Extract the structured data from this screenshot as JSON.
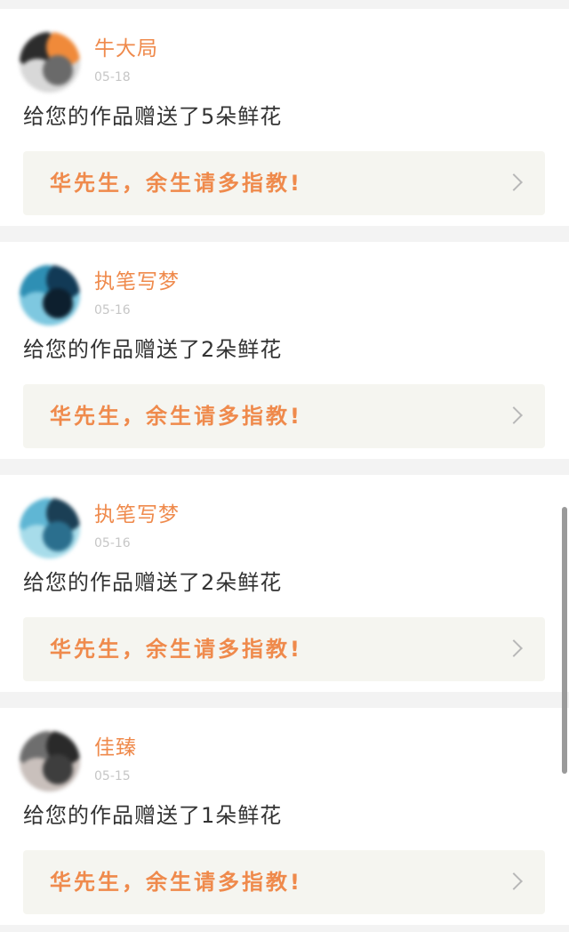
{
  "notifications": [
    {
      "username": "牛大局",
      "date": "05-18",
      "message": "给您的作品赠送了5朵鲜花",
      "work_title": "华先生，余生请多指教!",
      "avatar_colors": [
        "#2c2c2c",
        "#f08a3a",
        "#d8d8d8",
        "#6a6a6a"
      ]
    },
    {
      "username": "执笔写梦",
      "date": "05-16",
      "message": "给您的作品赠送了2朵鲜花",
      "work_title": "华先生，余生请多指教!",
      "avatar_colors": [
        "#2e8fb4",
        "#123a56",
        "#7ec8e0",
        "#0d1f2e"
      ]
    },
    {
      "username": "执笔写梦",
      "date": "05-16",
      "message": "给您的作品赠送了2朵鲜花",
      "work_title": "华先生，余生请多指教!",
      "avatar_colors": [
        "#5fb6d4",
        "#1b3f55",
        "#a7dcea",
        "#2b6f8e"
      ]
    },
    {
      "username": "佳臻",
      "date": "05-15",
      "message": "给您的作品赠送了1朵鲜花",
      "work_title": "华先生，余生请多指教!",
      "avatar_colors": [
        "#6e6e6e",
        "#2a2a2a",
        "#c9c0bc",
        "#3e3e3e"
      ]
    }
  ],
  "colors": {
    "accent": "#ef8a4c",
    "date": "#c6c6c6",
    "message": "#333333",
    "link_bg": "#f5f5f0",
    "page_bg": "#f3f3f3"
  }
}
